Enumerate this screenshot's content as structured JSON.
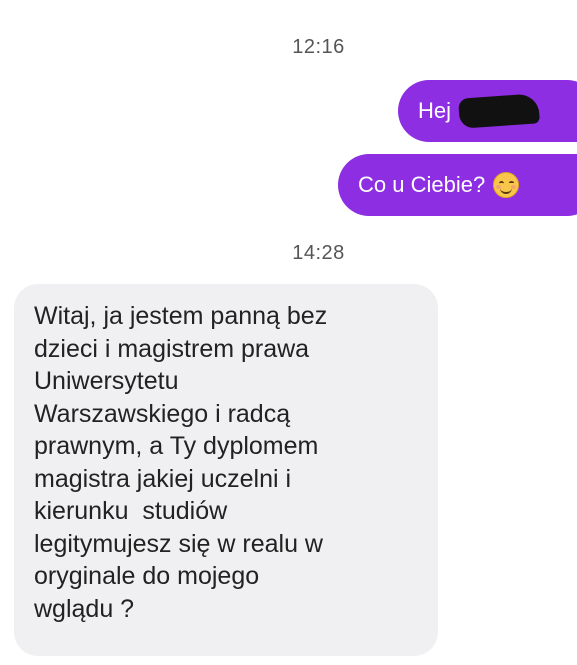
{
  "conversation": {
    "timestamps": [
      "12:16",
      "14:28"
    ],
    "outgoing": [
      {
        "text": "Hej",
        "redacted_name": true
      },
      {
        "text": "Co u Ciebie?",
        "emoji": "smiling-face-emoji"
      }
    ],
    "incoming": {
      "lines": [
        "Witaj, ja jestem panną bez",
        "dzieci i magistrem prawa",
        "Uniwersytetu",
        "Warszawskiego i radcą",
        "prawnym, a Ty dyplomem",
        "magistra jakiej uczelni i",
        "kierunku  studiów",
        "legitymujesz się w realu w",
        "oryginale do mojego",
        "wglądu ?"
      ]
    }
  },
  "colors": {
    "outgoing_bubble": "#8e2ee3",
    "incoming_bubble": "#f0f0f2",
    "timestamp": "#555555"
  }
}
